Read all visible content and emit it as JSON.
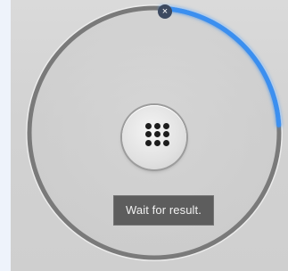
{
  "dialog": {
    "status_message": "Wait for result.",
    "close_glyph": "×",
    "progress_fraction": 0.24,
    "icons": {
      "center": "keypad-grid-icon",
      "close": "close-icon"
    },
    "colors": {
      "progress_arc": "#3b8ff0",
      "track_ring": "#7a7a7a",
      "toast_bg": "#5d5d5d",
      "toast_text": "#f2f2f2"
    }
  }
}
